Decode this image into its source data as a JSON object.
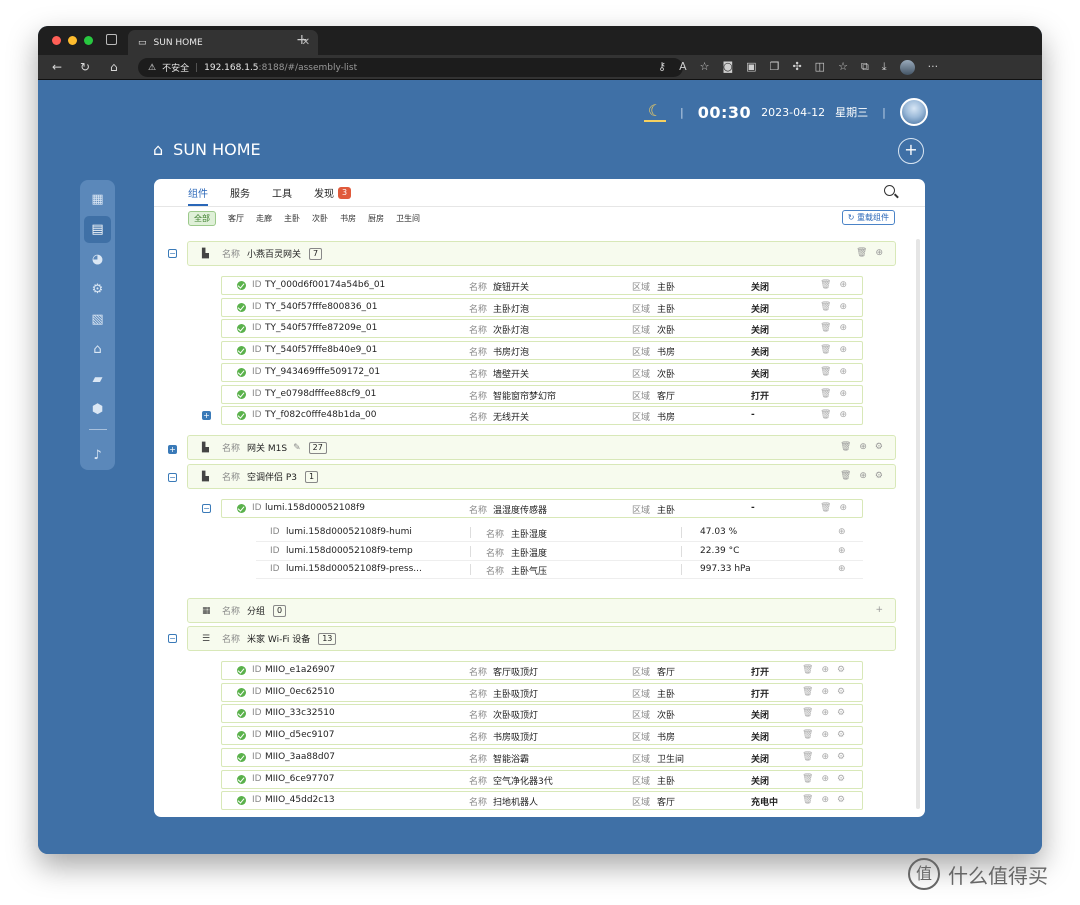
{
  "browser": {
    "tab_title": "SUN HOME",
    "insecure_label": "不安全",
    "url_host": "192.168.1.5",
    "url_path": ":8188/#/assembly-list"
  },
  "status": {
    "time": "00:30",
    "date": "2023-04-12",
    "weekday": "星期三"
  },
  "app": {
    "title": "SUN HOME"
  },
  "tabs": [
    {
      "label": "组件"
    },
    {
      "label": "服务"
    },
    {
      "label": "工具"
    },
    {
      "label": "发现",
      "badge": "3"
    }
  ],
  "filters": [
    "全部",
    "客厅",
    "走廊",
    "主卧",
    "次卧",
    "书房",
    "厨房",
    "卫生间"
  ],
  "reload_label": "重载组件",
  "labels": {
    "name": "名称",
    "id": "ID",
    "area": "区域"
  },
  "groups": [
    {
      "name": "小燕百灵网关",
      "count": "7"
    },
    {
      "name": "网关 M1S",
      "count": "27"
    },
    {
      "name": "空调伴侣 P3",
      "count": "1"
    },
    {
      "name": "分组",
      "count": "0"
    },
    {
      "name": "米家 Wi-Fi 设备",
      "count": "13"
    }
  ],
  "gateway_devices": [
    {
      "id": "TY_000d6f00174a54b6_01",
      "name": "旋钮开关",
      "area": "主卧",
      "state": "关闭"
    },
    {
      "id": "TY_540f57fffe800836_01",
      "name": "主卧灯泡",
      "area": "主卧",
      "state": "关闭"
    },
    {
      "id": "TY_540f57fffe87209e_01",
      "name": "次卧灯泡",
      "area": "次卧",
      "state": "关闭"
    },
    {
      "id": "TY_540f57fffe8b40e9_01",
      "name": "书房灯泡",
      "area": "书房",
      "state": "关闭"
    },
    {
      "id": "TY_943469fffe509172_01",
      "name": "墙壁开关",
      "area": "次卧",
      "state": "关闭"
    },
    {
      "id": "TY_e0798dfffee88cf9_01",
      "name": "智能窗帘梦幻帘",
      "area": "客厅",
      "state": "打开"
    },
    {
      "id": "TY_f082c0fffe48b1da_00",
      "name": "无线开关",
      "area": "书房",
      "state": "-"
    }
  ],
  "p3_device": {
    "id": "lumi.158d00052108f9",
    "name": "温湿度传感器",
    "area": "主卧",
    "state": "-"
  },
  "p3_subs": [
    {
      "id": "lumi.158d00052108f9-humi",
      "name": "主卧湿度",
      "value": "47.03 %"
    },
    {
      "id": "lumi.158d00052108f9-temp",
      "name": "主卧温度",
      "value": "22.39 °C"
    },
    {
      "id": "lumi.158d00052108f9-press...",
      "name": "主卧气压",
      "value": "997.33 hPa"
    }
  ],
  "wifi_devices": [
    {
      "id": "MIIO_e1a26907",
      "name": "客厅吸顶灯",
      "area": "客厅",
      "state": "打开"
    },
    {
      "id": "MIIO_0ec62510",
      "name": "主卧吸顶灯",
      "area": "主卧",
      "state": "打开"
    },
    {
      "id": "MIIO_33c32510",
      "name": "次卧吸顶灯",
      "area": "次卧",
      "state": "关闭"
    },
    {
      "id": "MIIO_d5ec9107",
      "name": "书房吸顶灯",
      "area": "书房",
      "state": "关闭"
    },
    {
      "id": "MIIO_3aa88d07",
      "name": "智能浴霸",
      "area": "卫生间",
      "state": "关闭"
    },
    {
      "id": "MIIO_6ce97707",
      "name": "空气净化器3代",
      "area": "主卧",
      "state": "关闭"
    },
    {
      "id": "MIIO_45dd2c13",
      "name": "扫地机器人",
      "area": "客厅",
      "state": "充电中"
    }
  ],
  "watermark": "什么值得买",
  "watermark_logo": "值"
}
